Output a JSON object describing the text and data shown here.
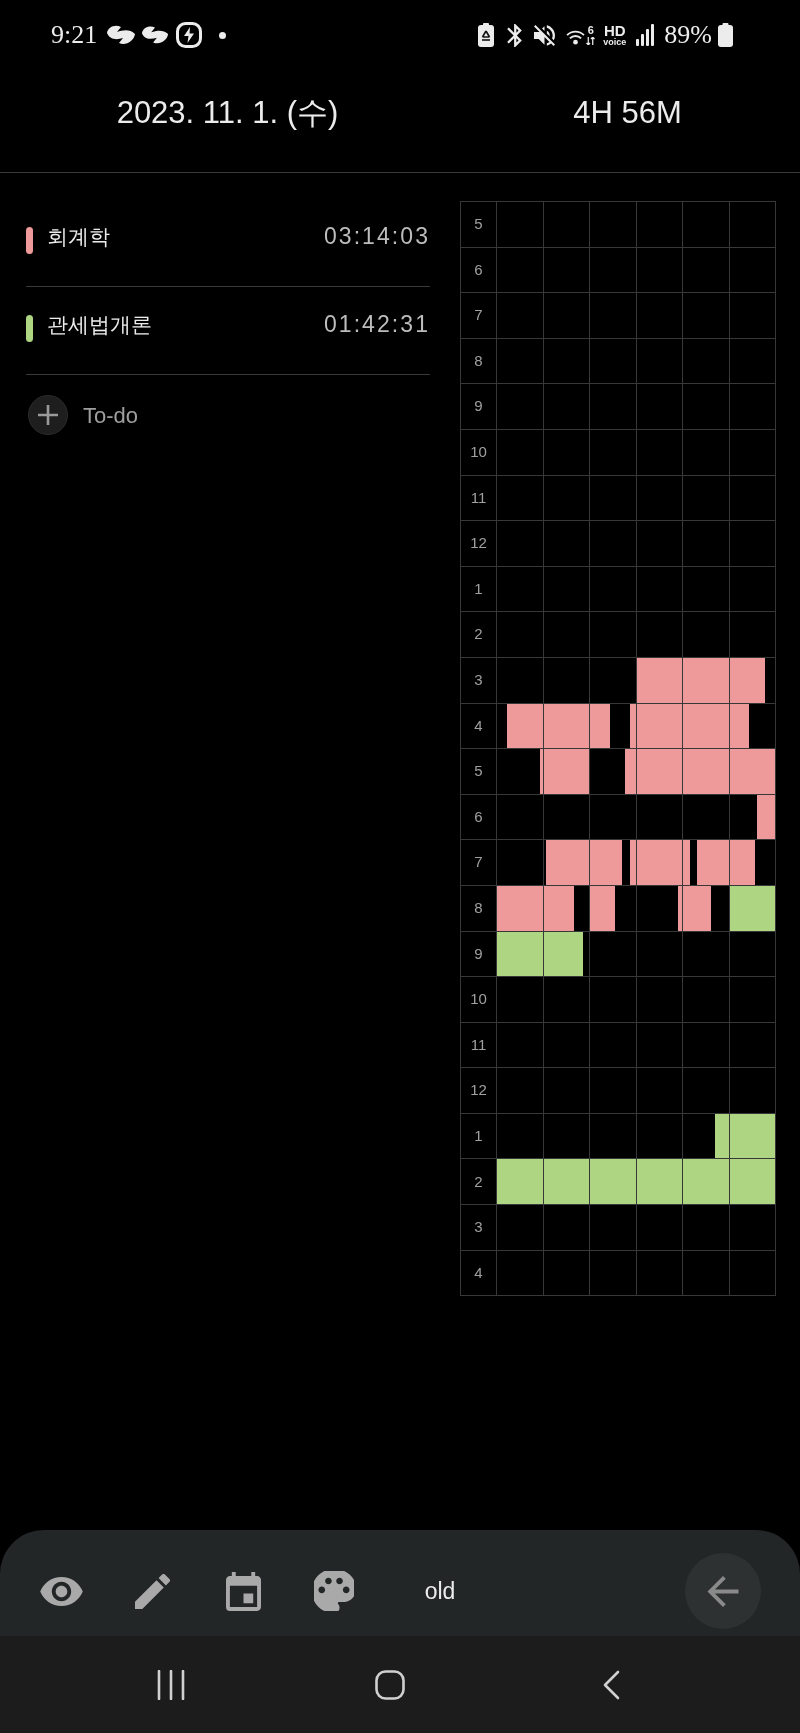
{
  "status_bar": {
    "time": "9:21",
    "wifi_badge": "6",
    "hd": "HD",
    "voice": "voice",
    "battery": "89%"
  },
  "header": {
    "date": "2023. 11. 1. (수)",
    "total": "4H 56M"
  },
  "subjects": [
    {
      "name": "회계학",
      "time": "03:14:03",
      "color": "#ef9a9a"
    },
    {
      "name": "관세법개론",
      "time": "01:42:31",
      "color": "#aed581"
    }
  ],
  "todo": {
    "label": "To-do"
  },
  "timetable": {
    "rows": [
      {
        "hour": "5"
      },
      {
        "hour": "6"
      },
      {
        "hour": "7"
      },
      {
        "hour": "8"
      },
      {
        "hour": "9"
      },
      {
        "hour": "10"
      },
      {
        "hour": "11"
      },
      {
        "hour": "12"
      },
      {
        "hour": "1"
      },
      {
        "hour": "2"
      },
      {
        "hour": "3",
        "cells": [
          {
            "kind": "empty"
          },
          {
            "kind": "empty"
          },
          {
            "kind": "empty"
          },
          {
            "kind": "full",
            "color": "#ef9a9a"
          },
          {
            "kind": "full",
            "color": "#ef9a9a"
          },
          {
            "kind": "start",
            "level": 0.77,
            "color": "#ef9a9a"
          }
        ]
      },
      {
        "hour": "4",
        "cells": [
          {
            "kind": "end",
            "level": 0.77,
            "color": "#ef9a9a"
          },
          {
            "kind": "full",
            "color": "#ef9a9a"
          },
          {
            "kind": "split",
            "fills": [
              {
                "kind": "start",
                "level": 0.45,
                "color": "#ef9a9a"
              },
              {
                "kind": "end",
                "level": 0.13,
                "color": "#ef9a9a"
              }
            ]
          },
          {
            "kind": "full",
            "color": "#ef9a9a"
          },
          {
            "kind": "full",
            "color": "#ef9a9a"
          },
          {
            "kind": "start",
            "level": 0.42,
            "color": "#ef9a9a"
          }
        ]
      },
      {
        "hour": "5",
        "cells": [
          {
            "kind": "end",
            "level": 0.05,
            "color": "#ef9a9a"
          },
          {
            "kind": "full",
            "color": "#ef9a9a"
          },
          {
            "kind": "end",
            "level": 0.23,
            "color": "#ef9a9a"
          },
          {
            "kind": "full",
            "color": "#ef9a9a"
          },
          {
            "kind": "full",
            "color": "#ef9a9a"
          },
          {
            "kind": "full",
            "color": "#ef9a9a"
          }
        ]
      },
      {
        "hour": "6",
        "cells": [
          {
            "kind": "empty"
          },
          {
            "kind": "empty"
          },
          {
            "kind": "empty"
          },
          {
            "kind": "empty"
          },
          {
            "kind": "empty"
          },
          {
            "kind": "end",
            "level": 0.39,
            "color": "#ef9a9a"
          }
        ]
      },
      {
        "hour": "7",
        "cells": [
          {
            "kind": "empty"
          },
          {
            "kind": "end",
            "level": 0.95,
            "color": "#ef9a9a"
          },
          {
            "kind": "split",
            "fills": [
              {
                "kind": "start",
                "level": 0.7,
                "color": "#ef9a9a"
              },
              {
                "kind": "end",
                "level": 0.13,
                "color": "#ef9a9a"
              }
            ]
          },
          {
            "kind": "full",
            "color": "#ef9a9a"
          },
          {
            "kind": "split",
            "fills": [
              {
                "kind": "start",
                "level": 0.16,
                "color": "#ef9a9a"
              },
              {
                "kind": "end",
                "level": 0.69,
                "color": "#ef9a9a"
              }
            ]
          },
          {
            "kind": "start",
            "level": 0.57,
            "color": "#ef9a9a"
          }
        ]
      },
      {
        "hour": "8",
        "cells": [
          {
            "kind": "full",
            "color": "#ef9a9a"
          },
          {
            "kind": "start",
            "level": 0.66,
            "color": "#ef9a9a"
          },
          {
            "kind": "start",
            "level": 0.55,
            "color": "#ef9a9a"
          },
          {
            "kind": "end",
            "level": 0.09,
            "color": "#ef9a9a"
          },
          {
            "kind": "start",
            "level": 0.62,
            "color": "#ef9a9a"
          },
          {
            "kind": "full",
            "color": "#aed581"
          }
        ]
      },
      {
        "hour": "9",
        "cells": [
          {
            "kind": "full",
            "color": "#aed581"
          },
          {
            "kind": "start",
            "level": 0.86,
            "color": "#aed581"
          },
          {
            "kind": "empty"
          },
          {
            "kind": "empty"
          },
          {
            "kind": "empty"
          },
          {
            "kind": "empty"
          }
        ]
      },
      {
        "hour": "10"
      },
      {
        "hour": "11"
      },
      {
        "hour": "12"
      },
      {
        "hour": "1",
        "cells": [
          {
            "kind": "empty"
          },
          {
            "kind": "empty"
          },
          {
            "kind": "empty"
          },
          {
            "kind": "empty"
          },
          {
            "kind": "end",
            "level": 0.29,
            "color": "#aed581"
          },
          {
            "kind": "full",
            "color": "#aed581"
          }
        ]
      },
      {
        "hour": "2",
        "cells": [
          {
            "kind": "full",
            "color": "#aed581"
          },
          {
            "kind": "full",
            "color": "#aed581"
          },
          {
            "kind": "full",
            "color": "#aed581"
          },
          {
            "kind": "full",
            "color": "#aed581"
          },
          {
            "kind": "full",
            "color": "#aed581"
          },
          {
            "kind": "full",
            "color": "#aed581"
          }
        ]
      },
      {
        "hour": "3"
      },
      {
        "hour": "4"
      }
    ]
  },
  "toolbar": {
    "label": "old"
  }
}
